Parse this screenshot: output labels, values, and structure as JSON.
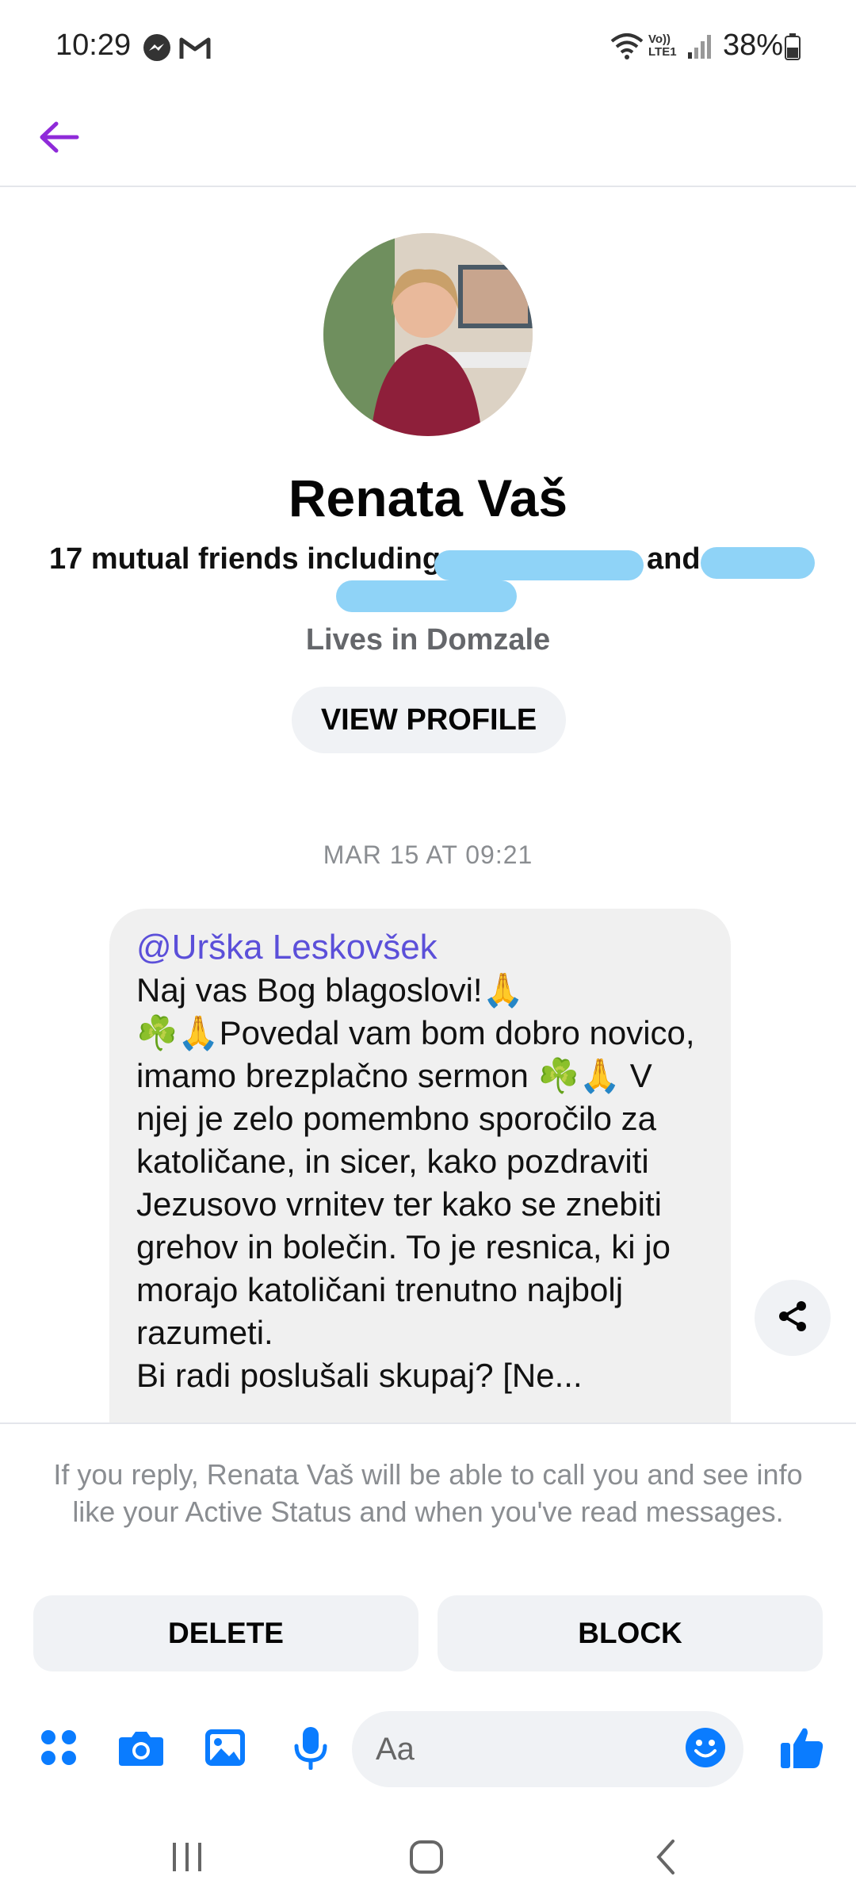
{
  "status_bar": {
    "time": "10:29",
    "battery": "38%",
    "network_label": "Vo)) LTE1"
  },
  "header": {
    "back_icon": "arrow-left-icon",
    "accent_color": "#8f2ad9"
  },
  "profile": {
    "name": "Renata Vaš",
    "mutual_friends_prefix": "17 mutual friends including",
    "mutual_friends_and": "and",
    "lives_in": "Lives in Domzale",
    "view_profile_label": "VIEW PROFILE"
  },
  "conversation": {
    "timestamp": "MAR 15 AT 09:21",
    "message": {
      "mention": "@Urška Leskovšek",
      "line1": "Naj vas Bog blagoslovi!🙏",
      "line2": "☘️🙏Povedal vam bom dobro novico, imamo brezplačno sermon ☘️🙏 V njej je zelo pomembno sporočilo za katoličane, in sicer, kako pozdraviti Jezusovo vrnitev ter kako se znebiti grehov in bolečin. To je resnica, ki jo morajo katoličani trenutno najbolj razumeti.",
      "line3": "Bi radi poslušali skupaj? [Ne..."
    }
  },
  "request": {
    "notice": "If you reply, Renata Vaš will be able to call you and see info like your Active Status and when you've read messages.",
    "delete_label": "DELETE",
    "block_label": "BLOCK"
  },
  "composer": {
    "placeholder": "Aa",
    "icons": [
      "apps-icon",
      "camera-icon",
      "gallery-icon",
      "microphone-icon",
      "emoji-icon",
      "thumbs-up-icon"
    ],
    "icon_color": "#0a7cff"
  }
}
